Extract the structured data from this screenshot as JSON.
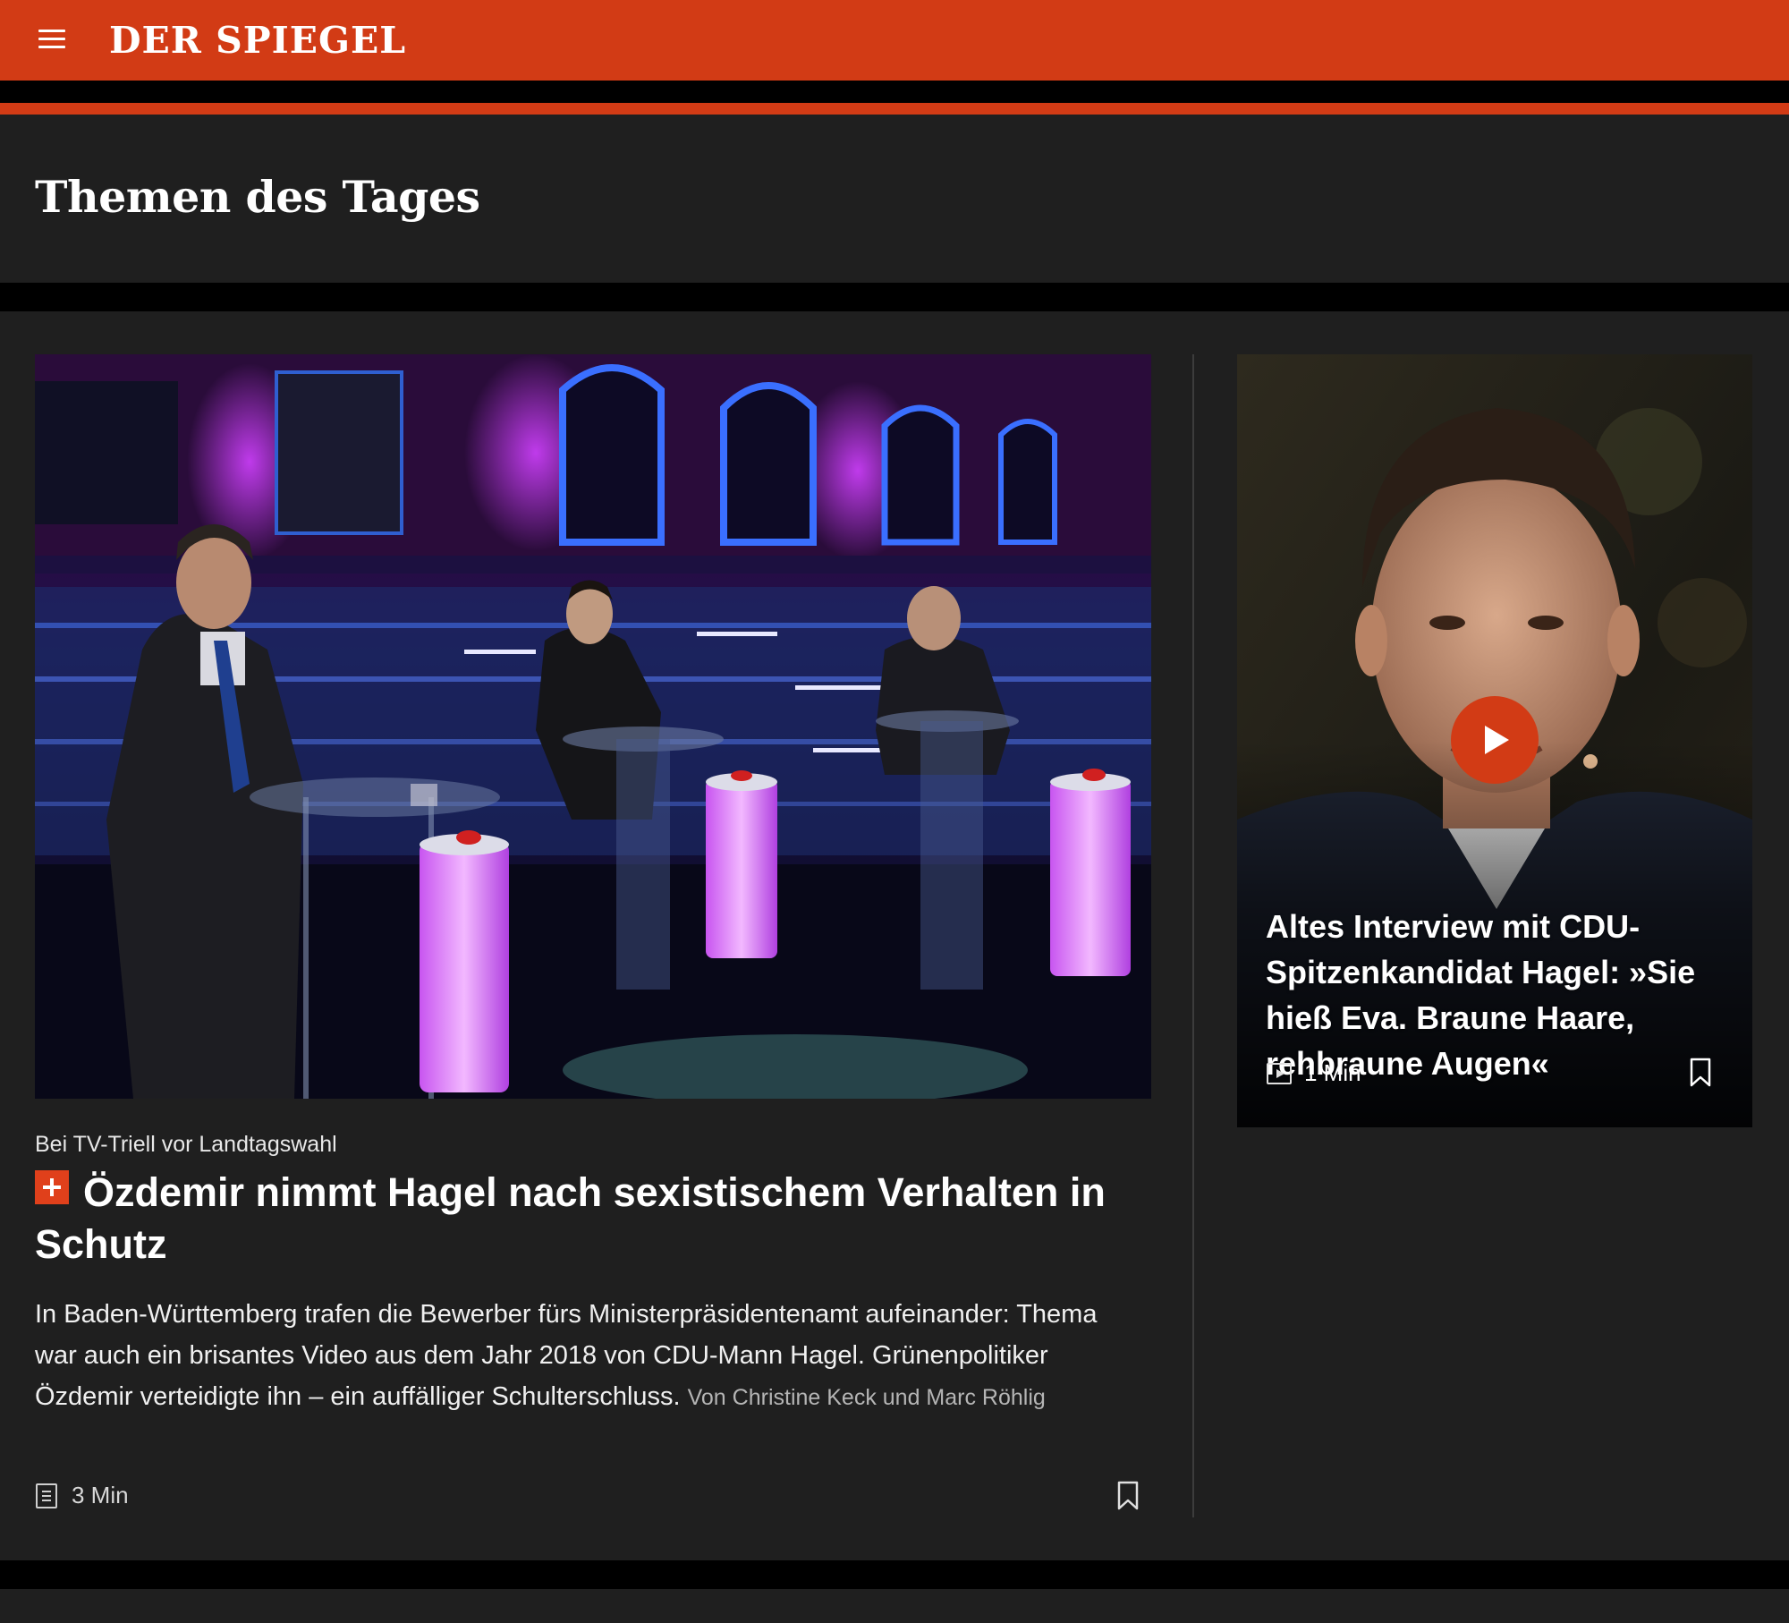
{
  "header": {
    "logo": "DER SPIEGEL",
    "menu_icon": "hamburger-menu-icon",
    "brand_color": "#d23b15"
  },
  "section": {
    "title": "Themen des Tages"
  },
  "main_article": {
    "kicker": "Bei TV-Triell vor Landtagswahl",
    "badge": "spiegel-plus-icon",
    "headline": "Özdemir nimmt Hagel nach sexistischem Verhalten in Schutz",
    "teaser": "In Baden-Württemberg trafen die Bewerber fürs Ministerpräsidentenamt aufeinander: Thema war auch ein brisantes Video aus dem Jahr 2018 von CDU-Mann Hagel. Grünenpolitiker Özdemir verteidigte ihn – ein auffälliger Schulterschluss.",
    "byline": "Von Christine Keck und Marc Röhlig",
    "read_time": "3 Min",
    "type_icon": "article-icon"
  },
  "video_article": {
    "headline": "Altes Interview mit CDU-Spitzenkandidat Hagel: »Sie hieß Eva. Braune Haare, rehbraune Augen«",
    "duration": "1 Min",
    "type_icon": "video-icon"
  }
}
